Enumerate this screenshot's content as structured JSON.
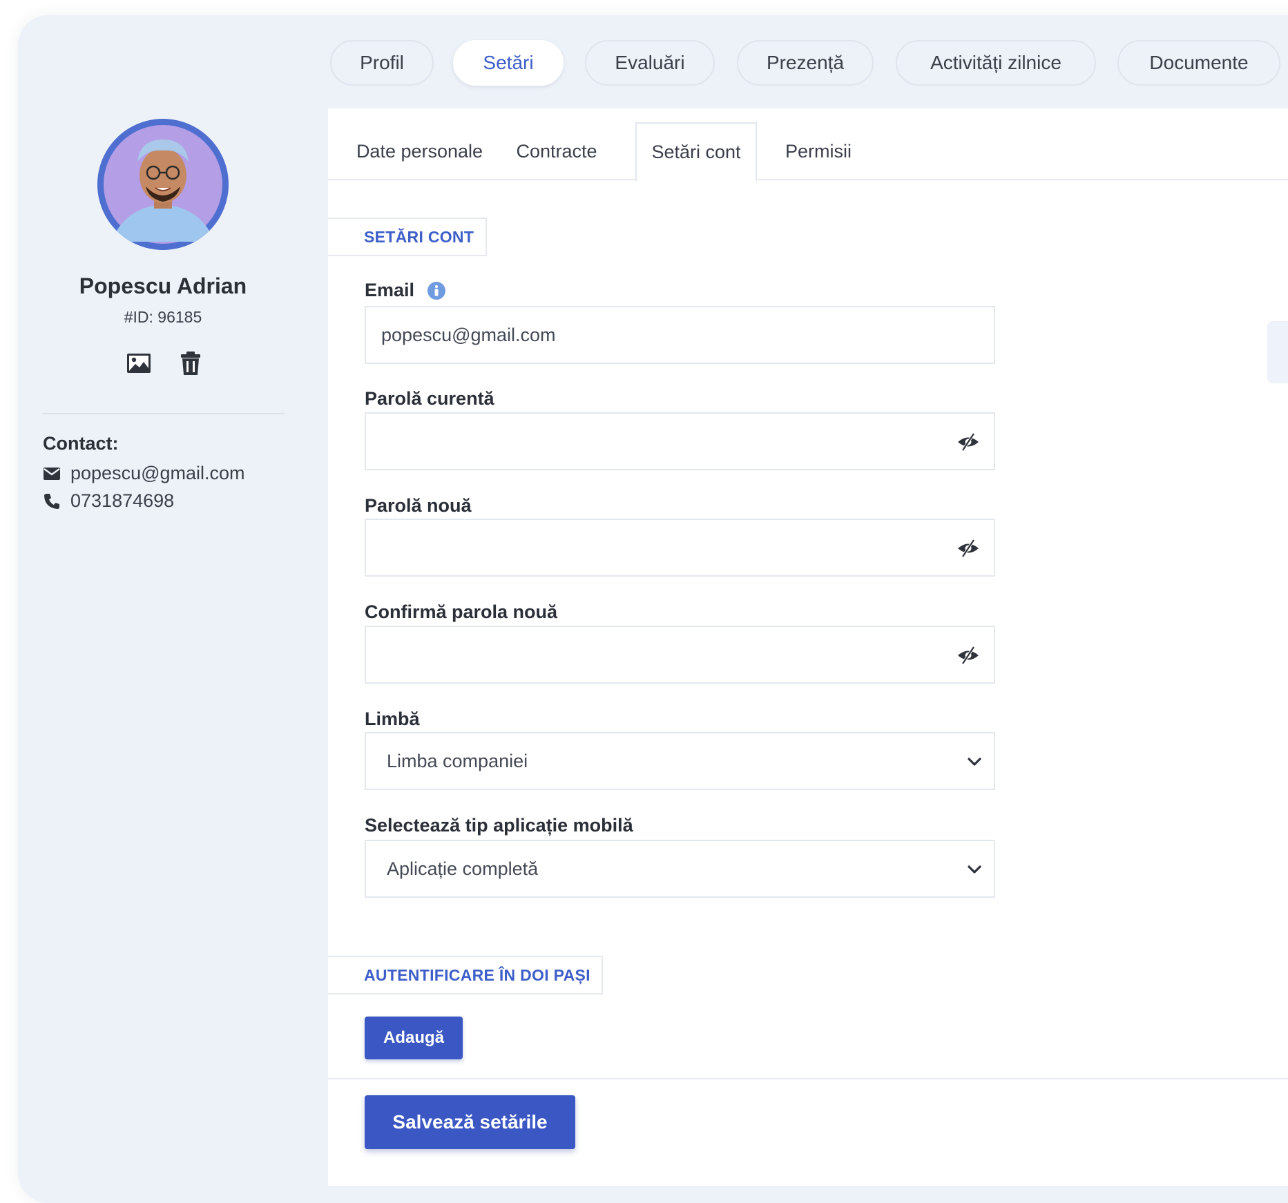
{
  "top_tabs": [
    {
      "label": "Profil",
      "active": false
    },
    {
      "label": "Setări",
      "active": true
    },
    {
      "label": "Evaluări",
      "active": false
    },
    {
      "label": "Prezență",
      "active": false
    },
    {
      "label": "Activități zilnice",
      "active": false
    },
    {
      "label": "Documente",
      "active": false
    }
  ],
  "profile": {
    "name": "Popescu Adrian",
    "id_text": "#ID: 96185",
    "contact_label": "Contact:",
    "email": "popescu@gmail.com",
    "phone": "0731874698",
    "actions": [
      "image-icon",
      "trash-icon"
    ]
  },
  "sub_tabs": [
    {
      "label": "Date personale",
      "active": false
    },
    {
      "label": "Contracte",
      "active": false
    },
    {
      "label": "Setări cont",
      "active": true
    },
    {
      "label": "Permisii",
      "active": false
    }
  ],
  "account_settings": {
    "section_title": "SETĂRI CONT",
    "email_label": "Email",
    "email_value": "popescu@gmail.com",
    "current_password_label": "Parolă curentă",
    "current_password_value": "",
    "new_password_label": "Parolă nouă",
    "new_password_value": "",
    "confirm_password_label": "Confirmă parola nouă",
    "confirm_password_value": "",
    "language_label": "Limbă",
    "language_value": "Limba companiei",
    "mobile_app_label": "Selectează tip aplicație mobilă",
    "mobile_app_value": "Aplicație completă"
  },
  "two_factor": {
    "section_title": "AUTENTIFICARE ÎN DOI PAȘI",
    "add_button": "Adaugă"
  },
  "save_button": "Salvează setările",
  "colors": {
    "accent": "#3b57c4",
    "accent_text": "#3d5ec8",
    "background": "#edf1f8",
    "info": "#6f9be0"
  }
}
